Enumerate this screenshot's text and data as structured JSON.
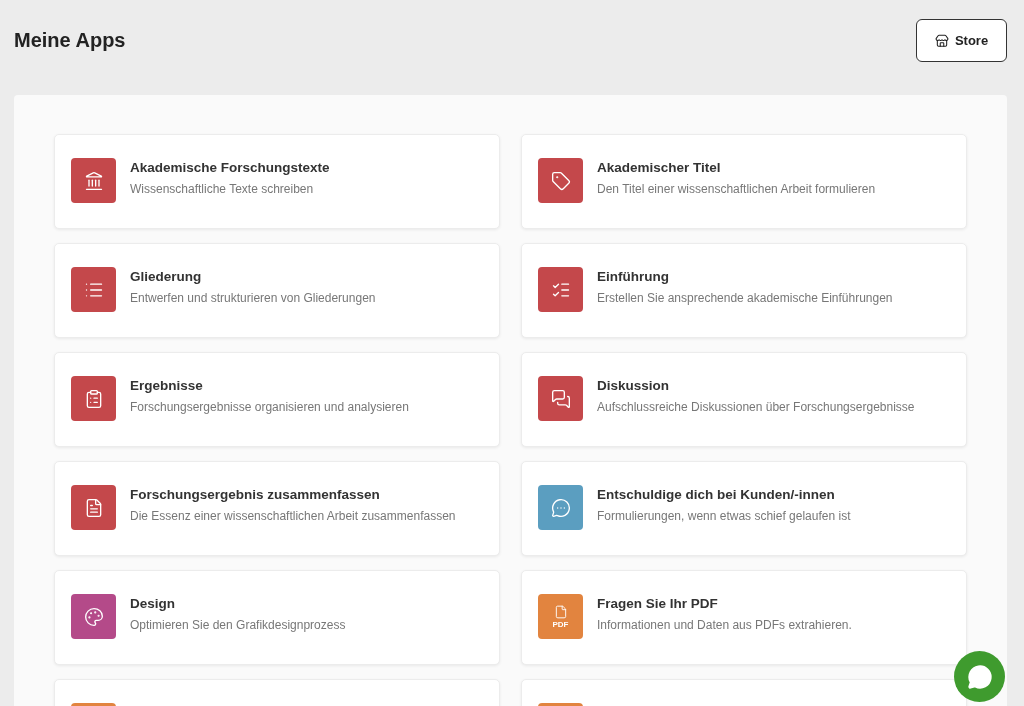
{
  "header": {
    "title": "Meine Apps",
    "store_button": "Store"
  },
  "apps": [
    {
      "title": "Akademische Forschungstexte",
      "description": "Wissenschaftliche Texte schreiben",
      "color": "#c4484b"
    },
    {
      "title": "Akademischer Titel",
      "description": "Den Titel einer wissenschaftlichen Arbeit formulieren",
      "color": "#c4484b"
    },
    {
      "title": "Gliederung",
      "description": "Entwerfen und strukturieren von Gliederungen",
      "color": "#c4484b"
    },
    {
      "title": "Einführung",
      "description": "Erstellen Sie ansprechende akademische Einführungen",
      "color": "#c4484b"
    },
    {
      "title": "Ergebnisse",
      "description": "Forschungsergebnisse organisieren und analysieren",
      "color": "#c4484b"
    },
    {
      "title": "Diskussion",
      "description": "Aufschlussreiche Diskussionen über Forschungsergebnisse",
      "color": "#c4484b"
    },
    {
      "title": "Forschungsergebnis zusammenfassen",
      "description": "Die Essenz einer wissenschaftlichen Arbeit zusammenfassen",
      "color": "#c4484b"
    },
    {
      "title": "Entschuldige dich bei Kunden/-innen",
      "description": "Formulierungen, wenn etwas schief gelaufen ist",
      "color": "#5b9ec0"
    },
    {
      "title": "Design",
      "description": "Optimieren Sie den Grafikdesignprozess",
      "color": "#b44a89"
    },
    {
      "title": "Fragen Sie Ihr PDF",
      "description": "Informationen und Daten aus PDFs extrahieren.",
      "icon_label": "PDF",
      "color": "#e2843f"
    },
    {
      "color": "#e2843f"
    },
    {
      "color": "#e2843f"
    }
  ]
}
